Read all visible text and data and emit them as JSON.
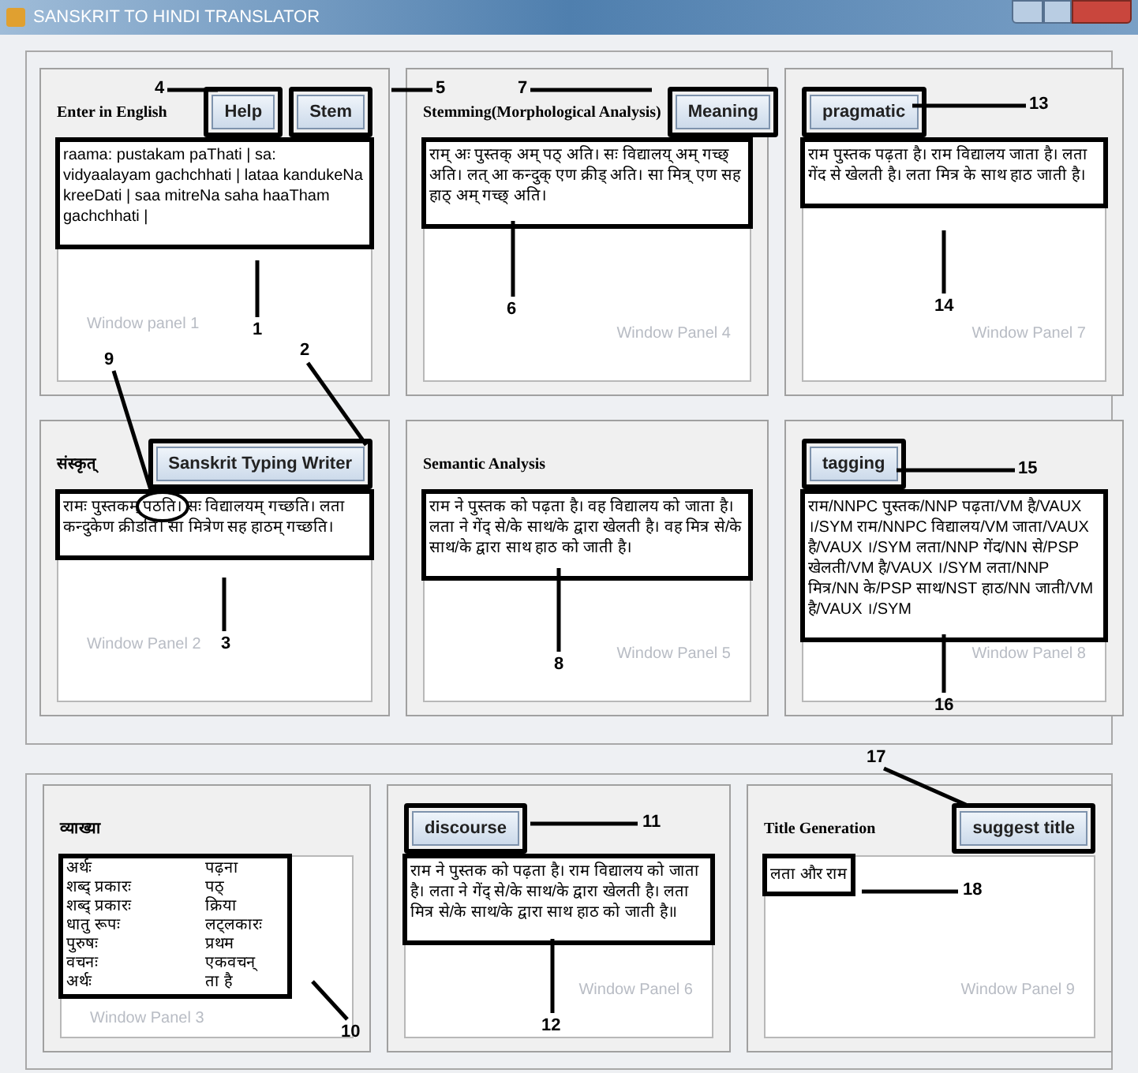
{
  "window": {
    "title": "SANSKRIT TO HINDI TRANSLATOR"
  },
  "frames": [
    {
      "panels": [
        {
          "label": "Enter in English",
          "buttons": [
            {
              "label": "Help",
              "highlighted": true
            },
            {
              "label": "Stem",
              "highlighted": true
            }
          ],
          "kind": "text",
          "text": "raama: pustakam paThati | sa: vidyaalayam gachchhati | lataa kandukeNa kreeDati | saa mitreNa saha haaTham gachchhati |",
          "text_highlighted": true,
          "panel_label": "Window panel 1"
        },
        {
          "label": "Stemming(Morphological Analysis)",
          "buttons": [
            {
              "label": "Meaning",
              "highlighted": true
            }
          ],
          "kind": "text",
          "text": "राम् अः पुस्तक् अम् पठ् अति। सः विद्यालय् अम् गच्छ् अति। लत् आ कन्दुक् एण क्रीड् अति। सा मित्र् एण सह हाठ् अम् गच्छ् अति।",
          "text_highlighted": true,
          "panel_label": "Window Panel 4"
        },
        {
          "buttons": [
            {
              "label": "pragmatic",
              "highlighted": true
            }
          ],
          "kind": "text",
          "text": "राम पुस्तक पढ़ता है। राम विद्यालय जाता है। लता गेंद से खेलती है। लता मित्र के साथ हाठ जाती है।",
          "text_highlighted": true,
          "panel_label": "Window Panel 7"
        },
        {
          "label": "संस्कृत्",
          "buttons": [
            {
              "label": "Sanskrit Typing Writer",
              "highlighted": true
            }
          ],
          "kind": "text",
          "text": "रामः पुस्तकम् पठति। सः विद्यालयम् गच्छति। लता कन्दुकेण क्रीडति। सा मित्रेण सह हाठम् गच्छति।",
          "text_highlighted": true,
          "panel_label": "Window Panel 2"
        },
        {
          "label": "Semantic Analysis",
          "kind": "text",
          "text": "राम ने पुस्तक को पढ़ता है। वह विद्यालय को जाता है। लता ने गेंद् से/के साथ/के द्वारा खेलती है। वह मित्र से/के साथ/के द्वारा साथ हाठ को जाती है।",
          "text_highlighted": true,
          "panel_label": "Window Panel 5"
        },
        {
          "buttons": [
            {
              "label": "tagging",
              "highlighted": true
            }
          ],
          "kind": "text",
          "text": "राम/NNPC पुस्तक/NNP पढ़ता/VM है/VAUX ।/SYM राम/NNPC विद्यालय/VM जाता/VAUX है/VAUX ।/SYM लता/NNP गेंद/NN से/PSP खेलती/VM है/VAUX ।/SYM लता/NNP मित्र/NN के/PSP साथ/NST हाठ/NN जाती/VM है/VAUX ।/SYM",
          "text_highlighted": true,
          "panel_label": "Window Panel 8"
        }
      ]
    },
    {
      "panels": [
        {
          "label": "व्याख्या",
          "kind": "table",
          "rows": [
            {
              "term": "अर्थः",
              "value": "पढ़ना"
            },
            {
              "term": "शब्द् प्रकारः",
              "value": "पठ्"
            },
            {
              "term": "शब्द् प्रकारः",
              "value": "क्रिया"
            },
            {
              "term": "धातु रूपः",
              "value": "लट्लकारः"
            },
            {
              "term": "पुरुषः",
              "value": "प्रथम"
            },
            {
              "term": "वचनः",
              "value": "एकवचन्"
            },
            {
              "term": "अर्थः",
              "value": "ता है"
            }
          ],
          "text_highlighted": true,
          "panel_label": "Window Panel 3"
        },
        {
          "buttons": [
            {
              "label": "discourse",
              "highlighted": true
            }
          ],
          "kind": "text",
          "text": "राम ने पुस्तक को पढ़ता है। राम विद्यालय को जाता है। लता ने गेंद् से/के साथ/के द्वारा खेलती है। लता मित्र से/के साथ/के द्वारा साथ हाठ को जाती है॥",
          "text_highlighted": true,
          "panel_label": "Window Panel 6"
        },
        {
          "label": "Title Generation",
          "buttons": [
            {
              "label": "suggest title",
              "highlighted": true
            }
          ],
          "kind": "short",
          "text": "लता और राम",
          "text_highlighted": true,
          "panel_label": "Window Panel 9"
        }
      ]
    }
  ],
  "callouts": [
    "1",
    "2",
    "3",
    "4",
    "5",
    "6",
    "7",
    "8",
    "9",
    "10",
    "11",
    "12",
    "13",
    "14",
    "15",
    "16",
    "17",
    "18"
  ]
}
